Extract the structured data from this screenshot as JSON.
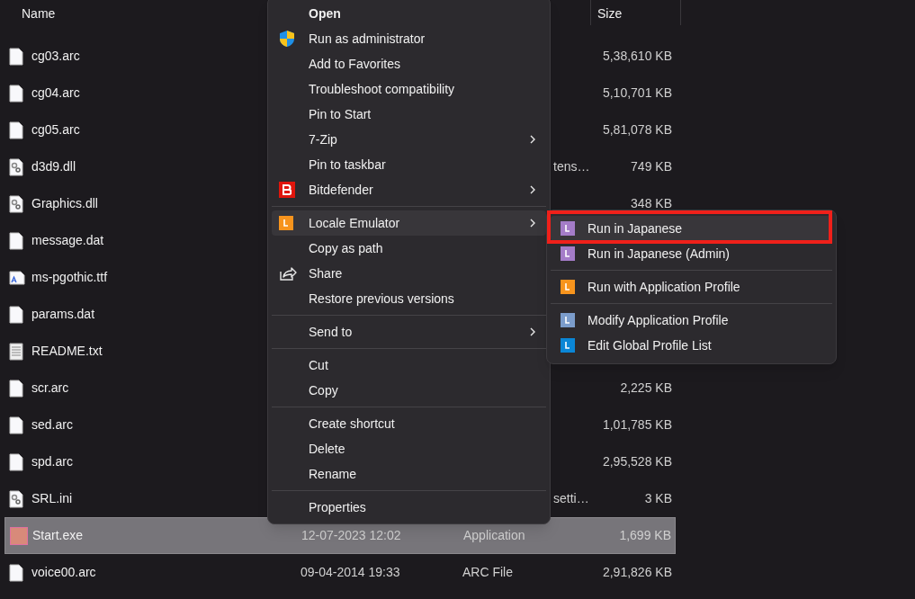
{
  "file_list": {
    "columns": [
      {
        "label": "Name"
      },
      {
        "label": "Size"
      }
    ],
    "rows": [
      {
        "kind": "blank",
        "name": "cg03.arc",
        "size": "5,38,610 KB",
        "selected": false
      },
      {
        "kind": "blank",
        "name": "cg04.arc",
        "size": "5,10,701 KB",
        "selected": false
      },
      {
        "kind": "blank",
        "name": "cg05.arc",
        "size": "5,81,078 KB",
        "selected": false
      },
      {
        "kind": "gear",
        "name": "d3d9.dll",
        "type": "tens…",
        "size": "749 KB",
        "selected": false
      },
      {
        "kind": "gear",
        "name": "Graphics.dll",
        "size": "348 KB",
        "selected": false
      },
      {
        "kind": "blank",
        "name": "message.dat",
        "selected": false
      },
      {
        "kind": "font",
        "name": "ms-pgothic.ttf",
        "selected": false
      },
      {
        "kind": "blank",
        "name": "params.dat",
        "selected": false
      },
      {
        "kind": "text",
        "name": "README.txt",
        "selected": false
      },
      {
        "kind": "blank",
        "name": "scr.arc",
        "size": "2,225 KB",
        "selected": false
      },
      {
        "kind": "blank",
        "name": "sed.arc",
        "size": "1,01,785 KB",
        "selected": false
      },
      {
        "kind": "blank",
        "name": "spd.arc",
        "size": "2,95,528 KB",
        "selected": false
      },
      {
        "kind": "gear",
        "name": "SRL.ini",
        "type": "setti…",
        "size": "3 KB",
        "selected": false
      },
      {
        "kind": "app",
        "name": "Start.exe",
        "date": "12-07-2023 12:02",
        "type": "Application",
        "size": "1,699 KB",
        "selected": true
      },
      {
        "kind": "blank",
        "name": "voice00.arc",
        "date": "09-04-2014 19:33",
        "type": "ARC File",
        "size": "2,91,826 KB",
        "selected": false
      }
    ]
  },
  "context_menu": {
    "groups": [
      [
        {
          "kind": "default",
          "label": "Open",
          "submenu": false,
          "selected": false
        },
        {
          "kind": "admin",
          "label": "Run as administrator",
          "submenu": false,
          "selected": false
        },
        {
          "kind": "plain",
          "label": "Add to Favorites",
          "submenu": false,
          "selected": false
        },
        {
          "kind": "plain",
          "label": "Troubleshoot compatibility",
          "submenu": false,
          "selected": false
        },
        {
          "kind": "plain",
          "label": "Pin to Start",
          "submenu": false,
          "selected": false
        },
        {
          "kind": "plain",
          "label": "7-Zip",
          "submenu": true,
          "selected": false
        },
        {
          "kind": "plain",
          "label": "Pin to taskbar",
          "submenu": false,
          "selected": false
        },
        {
          "kind": "antivirus",
          "label": "Bitdefender",
          "submenu": true,
          "selected": false
        }
      ],
      [
        {
          "kind": "locale",
          "label": "Locale Emulator",
          "submenu": true,
          "selected": true
        },
        {
          "kind": "plain",
          "label": "Copy as path",
          "submenu": false,
          "selected": false
        },
        {
          "kind": "share",
          "label": "Share",
          "submenu": false,
          "selected": false
        },
        {
          "kind": "plain",
          "label": "Restore previous versions",
          "submenu": false,
          "selected": false
        }
      ],
      [
        {
          "kind": "plain",
          "label": "Send to",
          "submenu": true,
          "selected": false
        }
      ],
      [
        {
          "kind": "plain",
          "label": "Cut",
          "submenu": false,
          "selected": false
        },
        {
          "kind": "plain",
          "label": "Copy",
          "submenu": false,
          "selected": false
        }
      ],
      [
        {
          "kind": "plain",
          "label": "Create shortcut",
          "submenu": false,
          "selected": false
        },
        {
          "kind": "plain",
          "label": "Delete",
          "submenu": false,
          "selected": false
        },
        {
          "kind": "plain",
          "label": "Rename",
          "submenu": false,
          "selected": false
        }
      ],
      [
        {
          "kind": "plain",
          "label": "Properties",
          "submenu": false,
          "selected": false
        }
      ]
    ]
  },
  "submenu": {
    "groups": [
      [
        {
          "label": "Run in Japanese",
          "color": "#a47cc8",
          "selected": true
        },
        {
          "label": "Run in Japanese (Admin)",
          "color": "#a47cc8",
          "selected": false
        }
      ],
      [
        {
          "label": "Run with Application Profile",
          "color": "#f7941d",
          "selected": false
        }
      ],
      [
        {
          "label": "Modify Application Profile",
          "color": "#7b9ccb",
          "selected": false
        },
        {
          "label": "Edit Global Profile List",
          "color": "#0a86d6",
          "selected": false
        }
      ]
    ]
  }
}
